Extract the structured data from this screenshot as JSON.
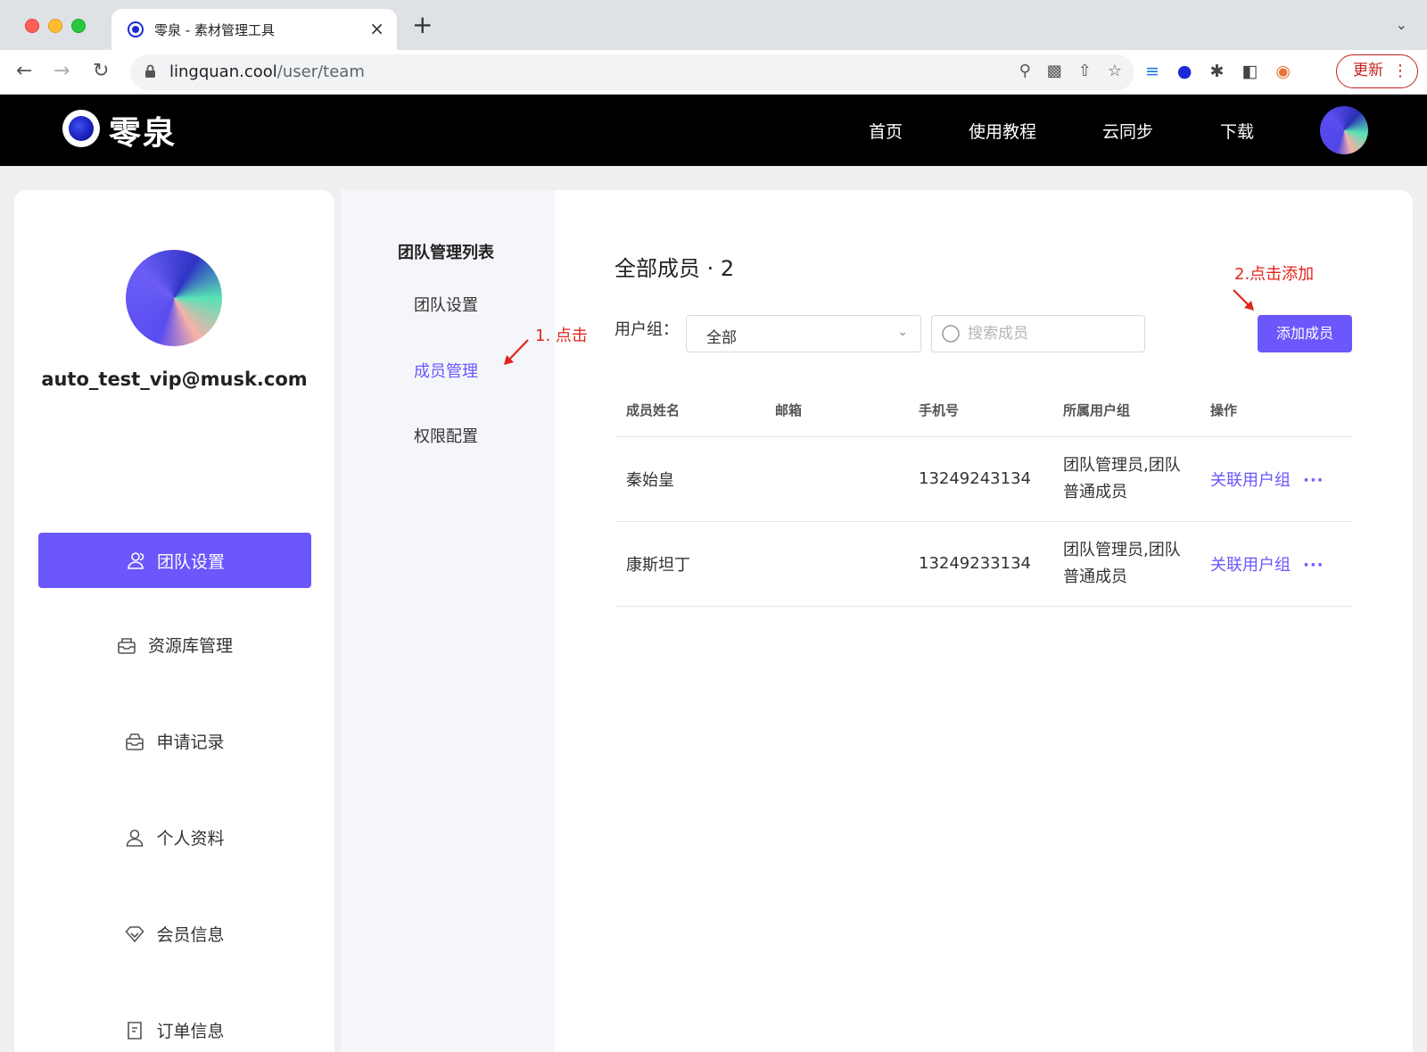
{
  "browser": {
    "tab_title": "零泉 - 素材管理工具",
    "tab_close": "×",
    "new_tab": "+",
    "url_host": "lingquan.cool",
    "url_path": "/user/team",
    "update_label": "更新"
  },
  "header": {
    "logo_text": "零泉",
    "nav": [
      "首页",
      "使用教程",
      "云同步",
      "下载"
    ]
  },
  "sidebar": {
    "email": "auto_test_vip@musk.com",
    "items": [
      {
        "label": "团队设置",
        "icon": "team-icon",
        "active": true
      },
      {
        "label": "资源库管理",
        "icon": "library-icon"
      },
      {
        "label": "申请记录",
        "icon": "inbox-icon"
      },
      {
        "label": "个人资料",
        "icon": "user-icon"
      },
      {
        "label": "会员信息",
        "icon": "diamond-icon"
      },
      {
        "label": "订单信息",
        "icon": "order-icon"
      }
    ],
    "accent_color": "#6b57fb"
  },
  "submenu": {
    "title": "团队管理列表",
    "items": [
      "团队设置",
      "成员管理",
      "权限配置"
    ],
    "active": "成员管理"
  },
  "main": {
    "title": "全部成员 · 2",
    "filter_label": "用户组：",
    "group_select_value": "全部",
    "search_placeholder": "搜索成员",
    "add_button": "添加成员",
    "columns": [
      "成员姓名",
      "邮箱",
      "手机号",
      "所属用户组",
      "操作"
    ],
    "rows": [
      {
        "name": "秦始皇",
        "email": "",
        "phone": "13249243134",
        "groups_line1": "团队管理员,团队",
        "groups_line2": "普通成员",
        "action": "关联用户组",
        "more": "···"
      },
      {
        "name": "康斯坦丁",
        "email": "",
        "phone": "13249233134",
        "groups_line1": "团队管理员,团队",
        "groups_line2": "普通成员",
        "action": "关联用户组",
        "more": "···"
      }
    ]
  },
  "annotations": {
    "step1": "1. 点击",
    "step2": "2.点击添加"
  }
}
